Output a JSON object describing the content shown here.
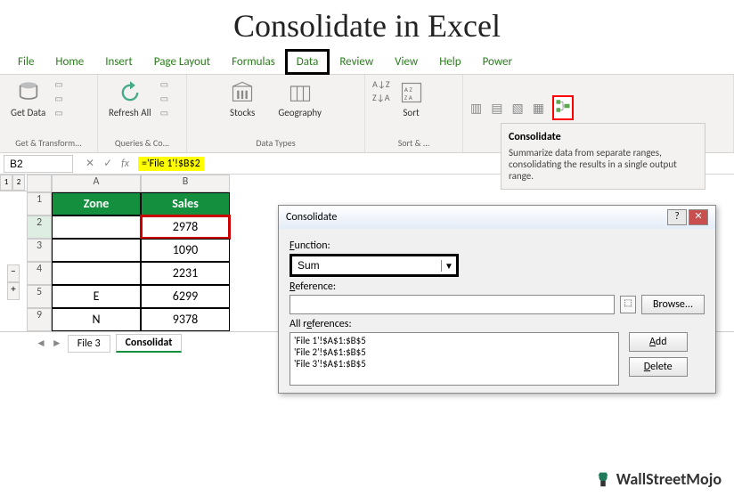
{
  "title": "Consolidate in Excel",
  "ribbon": {
    "tabs": [
      "File",
      "Home",
      "Insert",
      "Page Layout",
      "Formulas",
      "Data",
      "Review",
      "View",
      "Help",
      "Power"
    ],
    "active_tab": "Data",
    "groups": {
      "get_transform": {
        "label": "Get & Transform...",
        "get_data": "Get Data"
      },
      "queries": {
        "label": "Queries & Co...",
        "refresh_all": "Refresh All"
      },
      "data_types": {
        "label": "Data Types",
        "stocks": "Stocks",
        "geography": "Geography"
      },
      "sort_filter": {
        "label": "Sort & ...",
        "sort": "Sort",
        "az": "A↓Z",
        "za": "Z↓A"
      }
    }
  },
  "tooltip": {
    "title": "Consolidate",
    "body": "Summarize data from separate ranges, consolidating the results in a single output range."
  },
  "formula_bar": {
    "name_box": "B2",
    "formula": "='File 1'!$B$2"
  },
  "outline": {
    "levels": [
      "1",
      "2"
    ],
    "row_symbols": [
      "·",
      "·",
      "·",
      "−",
      "+"
    ]
  },
  "grid": {
    "columns": [
      "A",
      "B"
    ],
    "rows": [
      {
        "r": "1",
        "a": "Zone",
        "b": "Sales",
        "header": true
      },
      {
        "r": "2",
        "a": "",
        "b": "2978",
        "selected": true
      },
      {
        "r": "3",
        "a": "",
        "b": "1090"
      },
      {
        "r": "4",
        "a": "",
        "b": "2231"
      },
      {
        "r": "5",
        "a": "E",
        "b": "6299"
      },
      {
        "r": "9",
        "a": "N",
        "b": "9378"
      }
    ]
  },
  "sheet_tabs": {
    "tabs": [
      "File 3",
      "Consolidat"
    ],
    "active": "Consolidat"
  },
  "dialog": {
    "title": "Consolidate",
    "labels": {
      "function": "Function:",
      "reference": "Reference:",
      "all_refs": "All references:"
    },
    "function_value": "Sum",
    "reference_value": "",
    "all_references": [
      "'File 1'!$A$1:$B$5",
      "'File 2'!$A$1:$B$5",
      "'File 3'!$A$1:$B$5"
    ],
    "buttons": {
      "browse": "Browse...",
      "add": "Add",
      "delete": "Delete"
    }
  },
  "footer": {
    "brand": "WallStreetMojo"
  }
}
